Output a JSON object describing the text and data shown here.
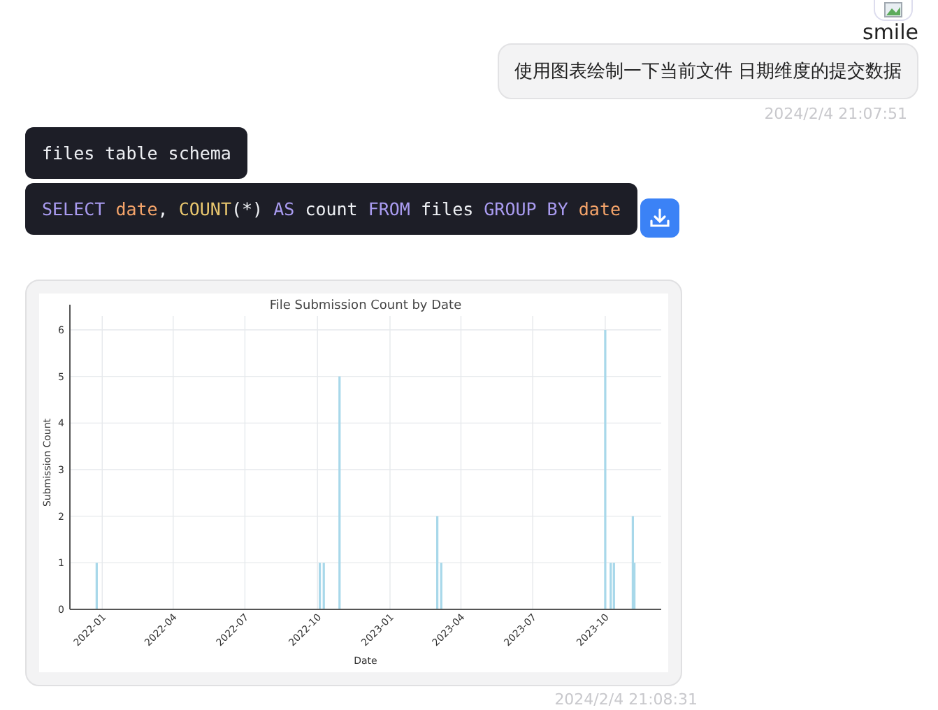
{
  "avatar": {
    "alt": "smile"
  },
  "user_message": {
    "text": "使用图表绘制一下当前文件 日期维度的提交数据",
    "time": "2024/2/4 21:07:51"
  },
  "schema_message": {
    "text": "files table schema"
  },
  "sql_message": {
    "tokens": [
      {
        "text": "SELECT ",
        "kind": "keyword"
      },
      {
        "text": "date",
        "kind": "identifier"
      },
      {
        "text": ", ",
        "kind": "plain"
      },
      {
        "text": "COUNT",
        "kind": "function"
      },
      {
        "text": "(*) ",
        "kind": "plain"
      },
      {
        "text": "AS",
        "kind": "keyword"
      },
      {
        "text": " count ",
        "kind": "plain"
      },
      {
        "text": "FROM",
        "kind": "keyword"
      },
      {
        "text": " files ",
        "kind": "plain"
      },
      {
        "text": "GROUP BY ",
        "kind": "keyword"
      },
      {
        "text": "date",
        "kind": "identifier"
      }
    ]
  },
  "chart_message": {
    "time": "2024/2/4 21:08:31",
    "chart_data": {
      "type": "bar",
      "title": "File Submission Count by Date",
      "xlabel": "Date",
      "ylabel": "Submission Count",
      "x": [
        "2021-12-25",
        "2022-10-04",
        "2022-10-09",
        "2022-10-29",
        "2023-03-02",
        "2023-03-07",
        "2023-10-01",
        "2023-10-08",
        "2023-10-12",
        "2023-11-05",
        "2023-11-07"
      ],
      "grid": true,
      "series": [
        {
          "color": "#a8d8ea",
          "values": [
            1,
            1,
            1,
            5,
            2,
            1,
            6,
            1,
            1,
            2,
            1
          ]
        }
      ],
      "xlim": [
        "2021-11-21",
        "2023-12-11"
      ],
      "ylim": [
        0,
        6.3
      ],
      "xticks": [
        {
          "value": "2022-01-01",
          "label": "2022-01"
        },
        {
          "value": "2022-04-01",
          "label": "2022-04"
        },
        {
          "value": "2022-07-01",
          "label": "2022-07"
        },
        {
          "value": "2022-10-01",
          "label": "2022-10"
        },
        {
          "value": "2023-01-01",
          "label": "2023-01"
        },
        {
          "value": "2023-04-01",
          "label": "2023-04"
        },
        {
          "value": "2023-07-01",
          "label": "2023-07"
        },
        {
          "value": "2023-10-01",
          "label": "2023-10"
        }
      ],
      "yticks": [
        0,
        1,
        2,
        3,
        4,
        5,
        6
      ]
    }
  }
}
